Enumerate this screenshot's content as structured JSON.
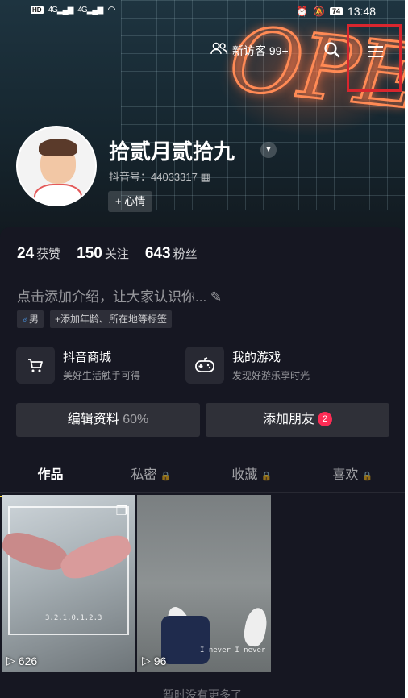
{
  "status_bar": {
    "network_left": "HD",
    "signal_1": "4G",
    "signal_2": "4G",
    "battery": "74",
    "time": "13:48"
  },
  "header": {
    "visitors_label": "新访客 99+",
    "icons": {
      "visitors": "people-icon",
      "search": "search-icon",
      "menu": "menu-icon"
    }
  },
  "profile": {
    "username": "拾贰月贰拾九",
    "douyin_id": "抖音号：44033317",
    "mood_button": "+ 心情"
  },
  "stats": [
    {
      "value": "24",
      "label": "获赞"
    },
    {
      "value": "150",
      "label": "关注"
    },
    {
      "value": "643",
      "label": "粉丝"
    }
  ],
  "bio": {
    "placeholder": "点击添加介绍，让大家认识你...",
    "gender_tag": "男",
    "add_tags": "+添加年龄、所在地等标签"
  },
  "shortcuts": [
    {
      "title": "抖音商城",
      "subtitle": "美好生活触手可得",
      "icon": "shopping-cart-icon"
    },
    {
      "title": "我的游戏",
      "subtitle": "发现好游乐享时光",
      "icon": "gamepad-icon"
    }
  ],
  "actions": {
    "edit_profile": "编辑资料",
    "edit_percent": "60%",
    "add_friends": "添加朋友",
    "add_friends_badge": "2"
  },
  "tabs": [
    {
      "label": "作品",
      "locked": false
    },
    {
      "label": "私密",
      "locked": true
    },
    {
      "label": "收藏",
      "locked": true
    },
    {
      "label": "喜欢",
      "locked": true
    }
  ],
  "videos": [
    {
      "plays": "626"
    },
    {
      "plays": "96",
      "caption": "I never I never"
    }
  ],
  "footer_hint": "暂时没有更多了"
}
